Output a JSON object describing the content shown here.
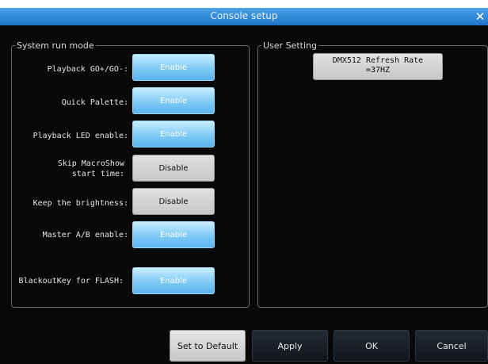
{
  "window": {
    "title": "Console setup",
    "close_glyph": "✕"
  },
  "system_run_mode": {
    "legend": "System run mode",
    "rows": [
      {
        "label": "Playback GO+/GO-:",
        "value": "Enable",
        "state": "on"
      },
      {
        "label": "Quick Palette:",
        "value": "Enable",
        "state": "on"
      },
      {
        "label": "Playback LED enable:",
        "value": "Enable",
        "state": "on"
      },
      {
        "label": "Skip MacroShow\nstart time:",
        "value": "Disable",
        "state": "off"
      },
      {
        "label": "Keep the brightness:",
        "value": "Disable",
        "state": "off"
      },
      {
        "label": "Master A/B enable:",
        "value": "Enable",
        "state": "on"
      },
      {
        "label": "BlackoutKey for FLASH:",
        "value": "Enable",
        "state": "on"
      }
    ]
  },
  "user_setting": {
    "legend": "User Setting",
    "refresh_line1": "DMX512 Refresh Rate",
    "refresh_line2": "=37HZ"
  },
  "footer": {
    "set_default": "Set to Default",
    "apply": "Apply",
    "ok": "OK",
    "cancel": "Cancel"
  },
  "colors": {
    "title_bar": "#2f8ad8",
    "enable_button": "#7fcaf6",
    "disable_button": "#c8c8c8",
    "background": "#080808"
  }
}
